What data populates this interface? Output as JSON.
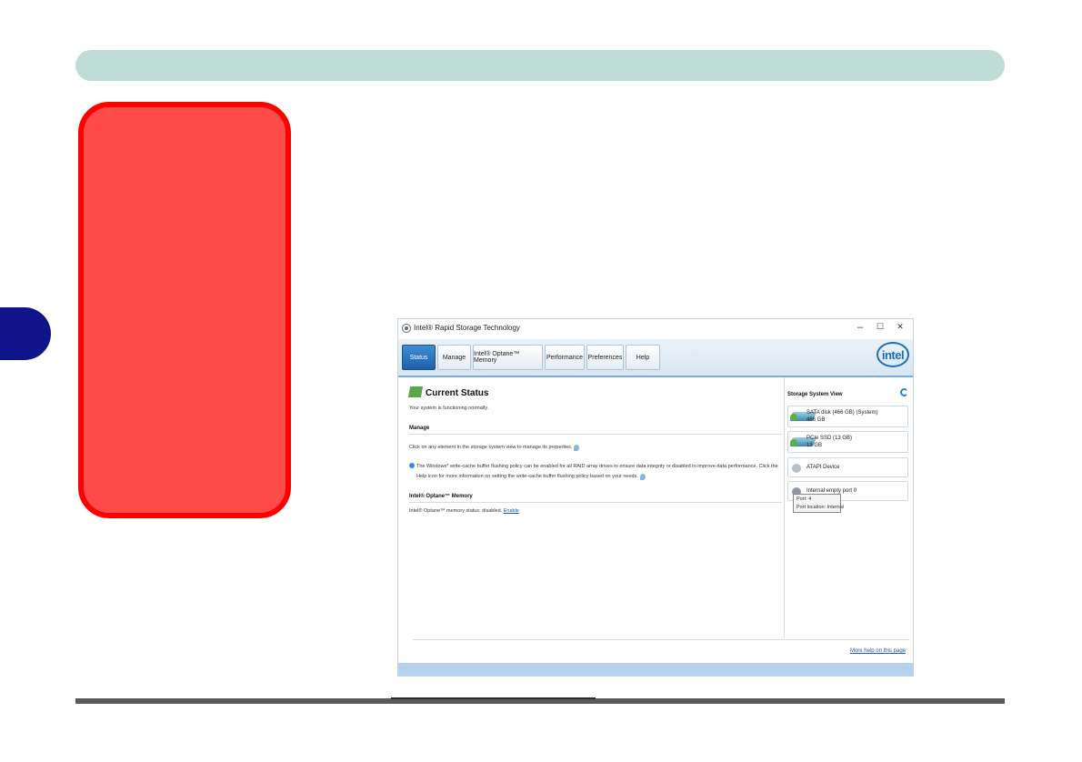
{
  "window": {
    "title": "Intel® Rapid Storage Technology",
    "controls": {
      "minimize": "–",
      "maximize": "☐",
      "close": "✕"
    }
  },
  "tabs": [
    {
      "label": "Status"
    },
    {
      "label": "Manage"
    },
    {
      "label": "Intel® Optane™ Memory"
    },
    {
      "label": "Performance"
    },
    {
      "label": "Preferences"
    },
    {
      "label": "Help"
    }
  ],
  "logo": {
    "text": "intel"
  },
  "main": {
    "title": "Current Status",
    "status_text": "Your system is functioning normally.",
    "manage": {
      "heading": "Manage",
      "instruction": "Click on any element in the storage system view to manage its properties.",
      "policy_line1": "The Windows* write-cache buffer flushing policy can be enabled for all RAID array drives to ensure data integrity or disabled to improve data performance. Click the",
      "policy_line2": "Help icon for more information on setting the write-cache buffer flushing policy based on your needs."
    },
    "optane": {
      "heading": "Intel® Optane™ Memory",
      "status_text": "Intel® Optane™ memory status: disabled.",
      "enable_link": "Enable"
    }
  },
  "storage_view": {
    "title": "Storage System View",
    "devices": [
      {
        "name": "SATA disk (466 GB) (System)",
        "size": "466 GB"
      },
      {
        "name": "PCIe SSD (13 GB)",
        "size": "13 GB"
      },
      {
        "name": "ATAPI Device",
        "size": ""
      },
      {
        "name": "Internal empty port 0",
        "size": ""
      }
    ],
    "tooltip": {
      "line1": "Port: 4",
      "line2": "Port location: Internal"
    }
  },
  "footer": {
    "more_help": "More help on this page"
  }
}
